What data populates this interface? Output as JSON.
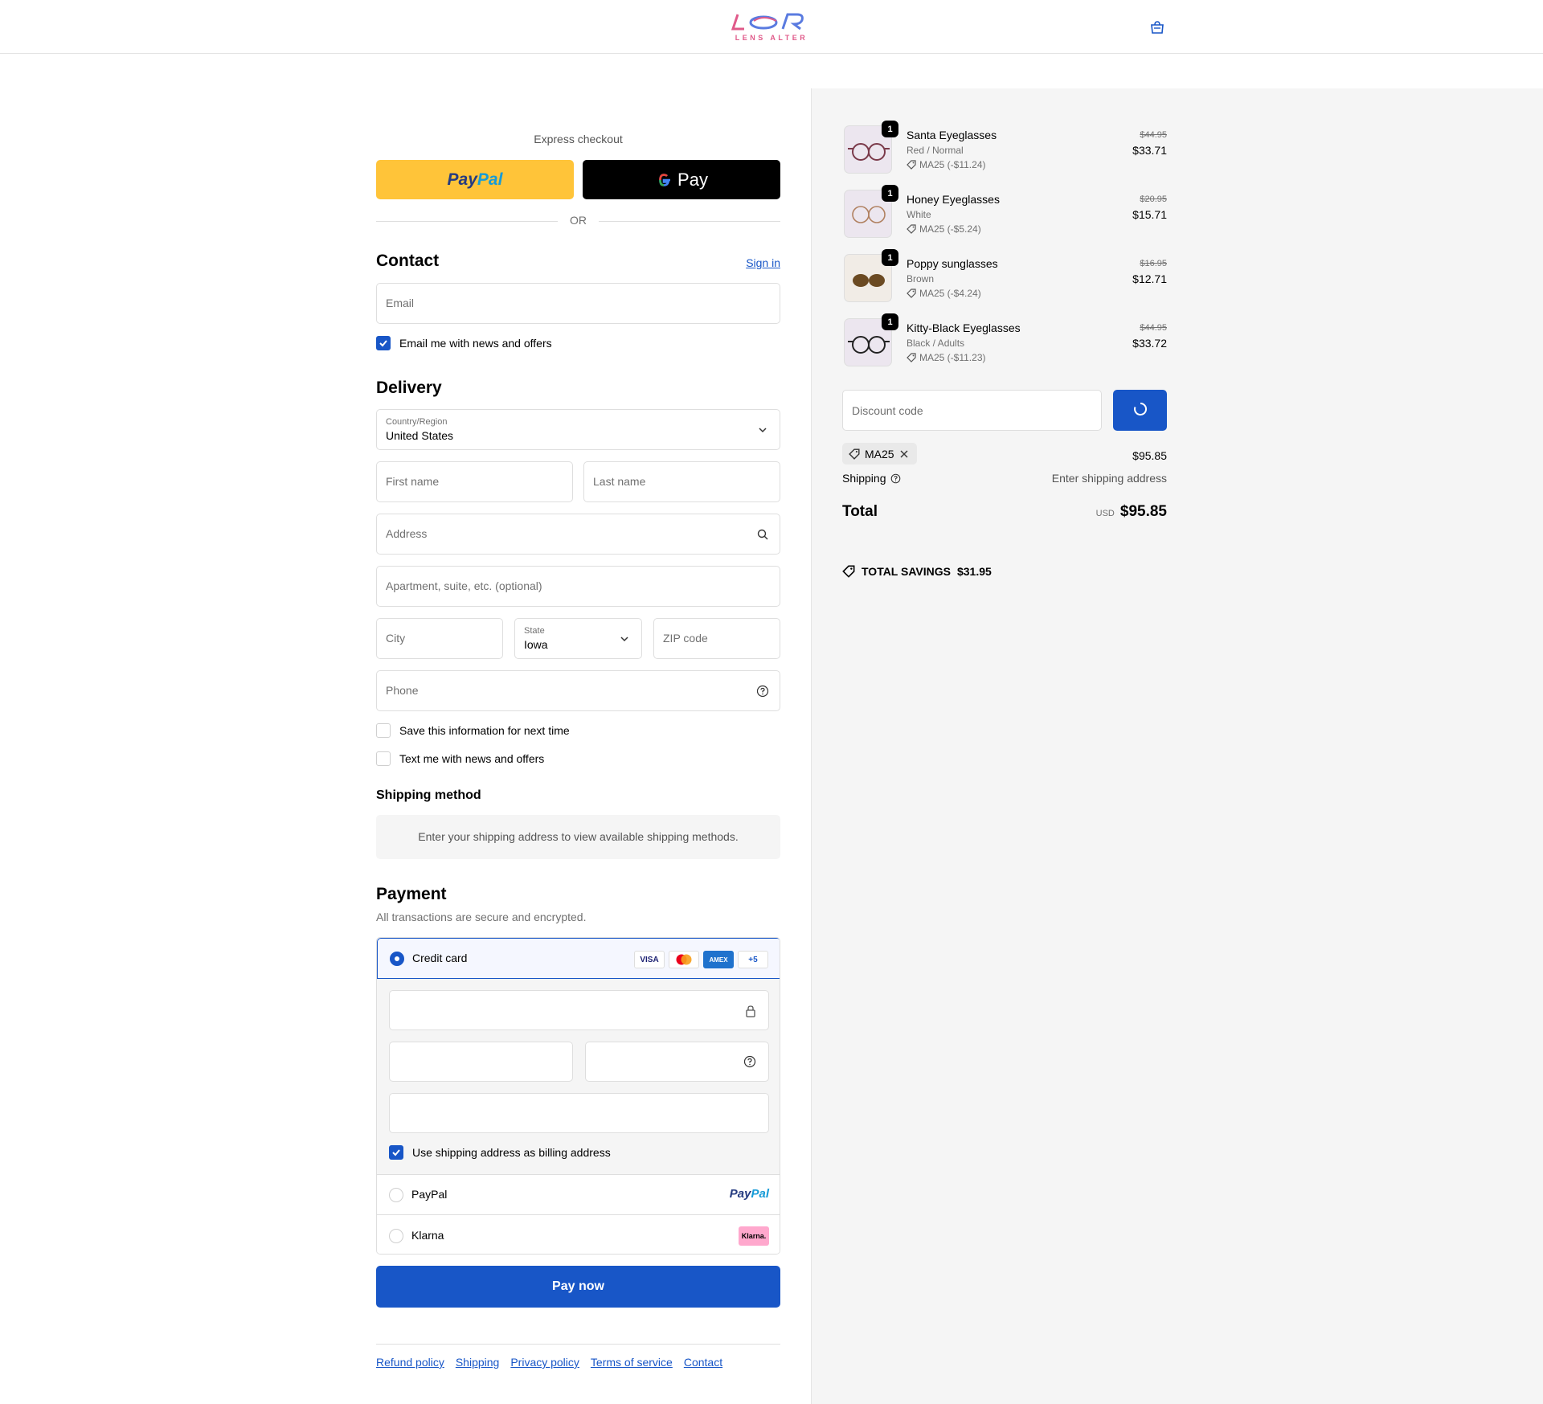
{
  "header": {
    "logo_mark": "LEOR",
    "logo_text": "LENS ALTER"
  },
  "express": {
    "label": "Express checkout",
    "paypal_a": "Pay",
    "paypal_b": "Pal",
    "gpay_label": "Pay",
    "or": "OR"
  },
  "contact": {
    "title": "Contact",
    "sign_in": "Sign in",
    "email_placeholder": "Email",
    "news_label": "Email me with news and offers"
  },
  "delivery": {
    "title": "Delivery",
    "country_label": "Country/Region",
    "country_value": "United States",
    "first_name": "First name",
    "last_name": "Last name",
    "address": "Address",
    "apartment": "Apartment, suite, etc. (optional)",
    "city": "City",
    "state_label": "State",
    "state_value": "Iowa",
    "zip": "ZIP code",
    "phone": "Phone",
    "save_info": "Save this information for next time",
    "text_me": "Text me with news and offers"
  },
  "shipping_method": {
    "title": "Shipping method",
    "message": "Enter your shipping address to view available shipping methods."
  },
  "payment": {
    "title": "Payment",
    "subtitle": "All transactions are secure and encrypted.",
    "credit_card": "Credit card",
    "badges": [
      "VISA",
      "",
      "AMEX",
      "+5"
    ],
    "billing_label": "Use shipping address as billing address",
    "paypal": "PayPal",
    "paypal_logo_a": "Pay",
    "paypal_logo_b": "Pal",
    "klarna": "Klarna",
    "klarna_logo": "Klarna.",
    "pay_now": "Pay now"
  },
  "footer": {
    "links": [
      "Refund policy",
      "Shipping",
      "Privacy policy",
      "Terms of service",
      "Contact"
    ]
  },
  "cart": {
    "items": [
      {
        "qty": "1",
        "name": "Santa Eyeglasses",
        "variant": "Red / Normal",
        "discount": "MA25 (-$11.24)",
        "orig": "$44.95",
        "price": "$33.71"
      },
      {
        "qty": "1",
        "name": "Honey Eyeglasses",
        "variant": "White",
        "discount": "MA25 (-$5.24)",
        "orig": "$20.95",
        "price": "$15.71"
      },
      {
        "qty": "1",
        "name": "Poppy sunglasses",
        "variant": "Brown",
        "discount": "MA25 (-$4.24)",
        "orig": "$16.95",
        "price": "$12.71"
      },
      {
        "qty": "1",
        "name": "Kitty-Black Eyeglasses",
        "variant": "Black / Adults",
        "discount": "MA25 (-$11.23)",
        "orig": "$44.95",
        "price": "$33.72"
      }
    ],
    "discount_placeholder": "Discount code",
    "applied_code": "MA25",
    "subtotal_value": "$95.85",
    "shipping_label": "Shipping",
    "shipping_value": "Enter shipping address",
    "total_label": "Total",
    "currency": "USD",
    "total_value": "$95.85",
    "savings_label": "TOTAL SAVINGS",
    "savings_value": "$31.95"
  },
  "colors": {
    "accent": "#1856c7",
    "paypal_yellow": "#ffc439",
    "panel_bg": "#f5f5f5"
  }
}
